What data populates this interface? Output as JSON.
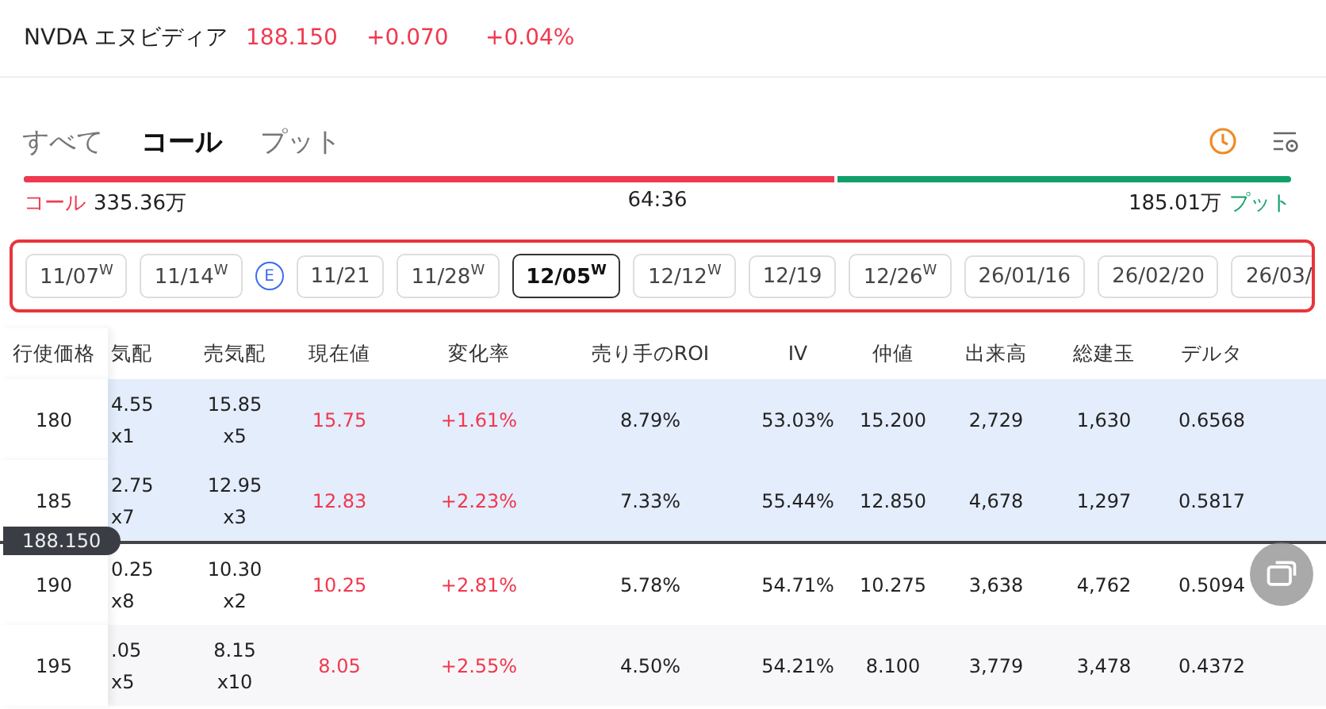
{
  "quote": {
    "symbol": "NVDA エヌビディア",
    "price": "188.150",
    "change": "+0.070",
    "change_pct": "+0.04%"
  },
  "tabs": [
    {
      "label": "すべて",
      "selected": false
    },
    {
      "label": "コール",
      "selected": true
    },
    {
      "label": "プット",
      "selected": false
    }
  ],
  "ratio": {
    "call_label": "コール",
    "call_value": "335.36万",
    "ratio": "64:36",
    "put_value": "185.01万",
    "put_label": "プット",
    "level": 0.64
  },
  "expiries": [
    {
      "kind": "date",
      "label": "11/07$^{W}$",
      "selected": false
    },
    {
      "kind": "date",
      "label": "11/14$^{W}$",
      "selected": false
    },
    {
      "kind": "earnings",
      "label": "E"
    },
    {
      "kind": "date",
      "label": "11/21",
      "selected": false
    },
    {
      "kind": "date",
      "label": "11/28$^{W}$",
      "selected": false
    },
    {
      "kind": "date",
      "label": "12/05$^{W}$",
      "selected": true
    },
    {
      "kind": "date",
      "label": "12/12$^{W}$",
      "selected": false
    },
    {
      "kind": "date",
      "label": "12/19",
      "selected": false
    },
    {
      "kind": "date",
      "label": "12/26$^{W}$",
      "selected": false
    },
    {
      "kind": "date",
      "label": "26/01/16",
      "selected": false
    },
    {
      "kind": "date",
      "label": "26/02/20",
      "selected": false
    },
    {
      "kind": "date",
      "label": "26/03/",
      "selected": false
    }
  ],
  "table": {
    "columns": [
      "行使価格",
      "気配",
      "売気配",
      "現在値",
      "変化率",
      "売り手のROI",
      "IV",
      "仲値",
      "出来高",
      "総建玉",
      "デルタ"
    ],
    "rows": [
      {
        "in_the_money": true,
        "cells": [
          "180",
          "4.55\nx1",
          "15.85\nx5",
          "15.75",
          "+1.61%",
          "8.79%",
          "53.03%",
          "15.200",
          "2,729",
          "1,630",
          "0.6568"
        ]
      },
      {
        "in_the_money": true,
        "cells": [
          "185",
          "2.75\nx7",
          "12.95\nx3",
          "12.83",
          "+2.23%",
          "7.33%",
          "55.44%",
          "12.850",
          "4,678",
          "1,297",
          "0.5817"
        ]
      },
      {
        "in_the_money": false,
        "cells": [
          "190",
          "0.25\nx8",
          "10.30\nx2",
          "10.25",
          "+2.81%",
          "5.78%",
          "54.71%",
          "10.275",
          "3,638",
          "4,762",
          "0.5094"
        ]
      },
      {
        "in_the_money": false,
        "cells": [
          "195",
          ".05\nx5",
          "8.15\nx10",
          "8.05",
          "+2.55%",
          "4.50%",
          "54.21%",
          "8.100",
          "3,779",
          "3,478",
          "0.4372"
        ]
      }
    ],
    "price_line": "188.150"
  }
}
